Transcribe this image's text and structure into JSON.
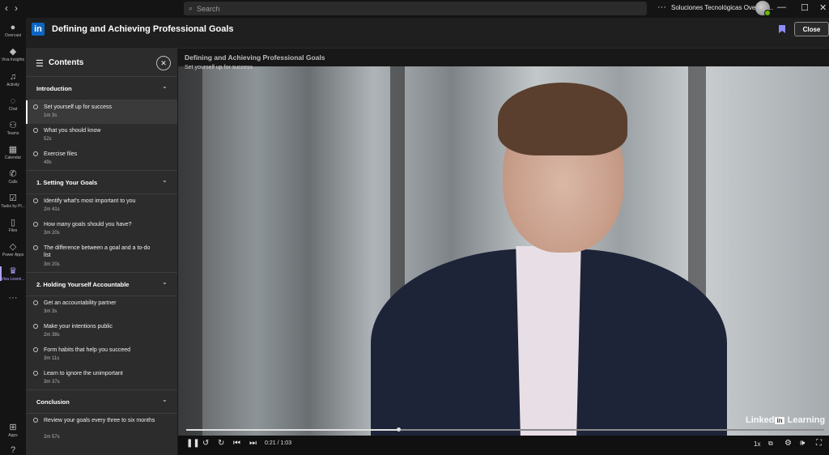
{
  "titlebar": {
    "search_placeholder": "Search",
    "org_name": "Soluciones Tecnológicas Overcas..."
  },
  "rail": {
    "items": [
      {
        "label": "Overcast",
        "icon": "overcast-icon"
      },
      {
        "label": "Viva Insights",
        "icon": "insights-icon"
      },
      {
        "label": "Activity",
        "icon": "bell-icon"
      },
      {
        "label": "Chat",
        "icon": "chat-icon"
      },
      {
        "label": "Teams",
        "icon": "teams-icon"
      },
      {
        "label": "Calendar",
        "icon": "calendar-icon"
      },
      {
        "label": "Calls",
        "icon": "phone-icon"
      },
      {
        "label": "Tasks by Pl...",
        "icon": "tasks-icon"
      },
      {
        "label": "Files",
        "icon": "file-icon"
      },
      {
        "label": "Power Apps",
        "icon": "power-apps-icon"
      },
      {
        "label": "Viva Learni...",
        "icon": "viva-learning-icon"
      }
    ],
    "apps_label": "Apps"
  },
  "header": {
    "title": "Defining and Achieving Professional Goals",
    "close_label": "Close",
    "accent": "#0a66c2"
  },
  "sidebar": {
    "title": "Contents",
    "sections": [
      {
        "title": "Introduction",
        "items": [
          {
            "title": "Set yourself up for success",
            "duration": "1m 3s",
            "active": true
          },
          {
            "title": "What you should know",
            "duration": "52s"
          },
          {
            "title": "Exercise files",
            "duration": "49s"
          }
        ]
      },
      {
        "title": "1. Setting Your Goals",
        "items": [
          {
            "title": "Identify what's most important to you",
            "duration": "2m 41s"
          },
          {
            "title": "How many goals should you have?",
            "duration": "3m 20s"
          },
          {
            "title": "The difference between a goal and a to-do list",
            "duration": "3m 20s"
          }
        ]
      },
      {
        "title": "2. Holding Yourself Accountable",
        "items": [
          {
            "title": "Get an accountability partner",
            "duration": "3m 3s"
          },
          {
            "title": "Make your intentions public",
            "duration": "2m 38s"
          },
          {
            "title": "Form habits that help you succeed",
            "duration": "3m 11s"
          },
          {
            "title": "Learn to ignore the unimportant",
            "duration": "3m 37s"
          }
        ]
      },
      {
        "title": "Conclusion",
        "items": [
          {
            "title": "Review your goals every three to six months",
            "duration": "2m 57s"
          }
        ]
      }
    ]
  },
  "video": {
    "course_title": "Defining and Achieving Professional Goals",
    "chapter_title": "Set yourself up for success",
    "watermark": "Learning",
    "watermark_prefix": "Linked",
    "watermark_in": "in",
    "time_display": "0:21 / 1:03",
    "progress": 0.333,
    "speed": "1x"
  }
}
